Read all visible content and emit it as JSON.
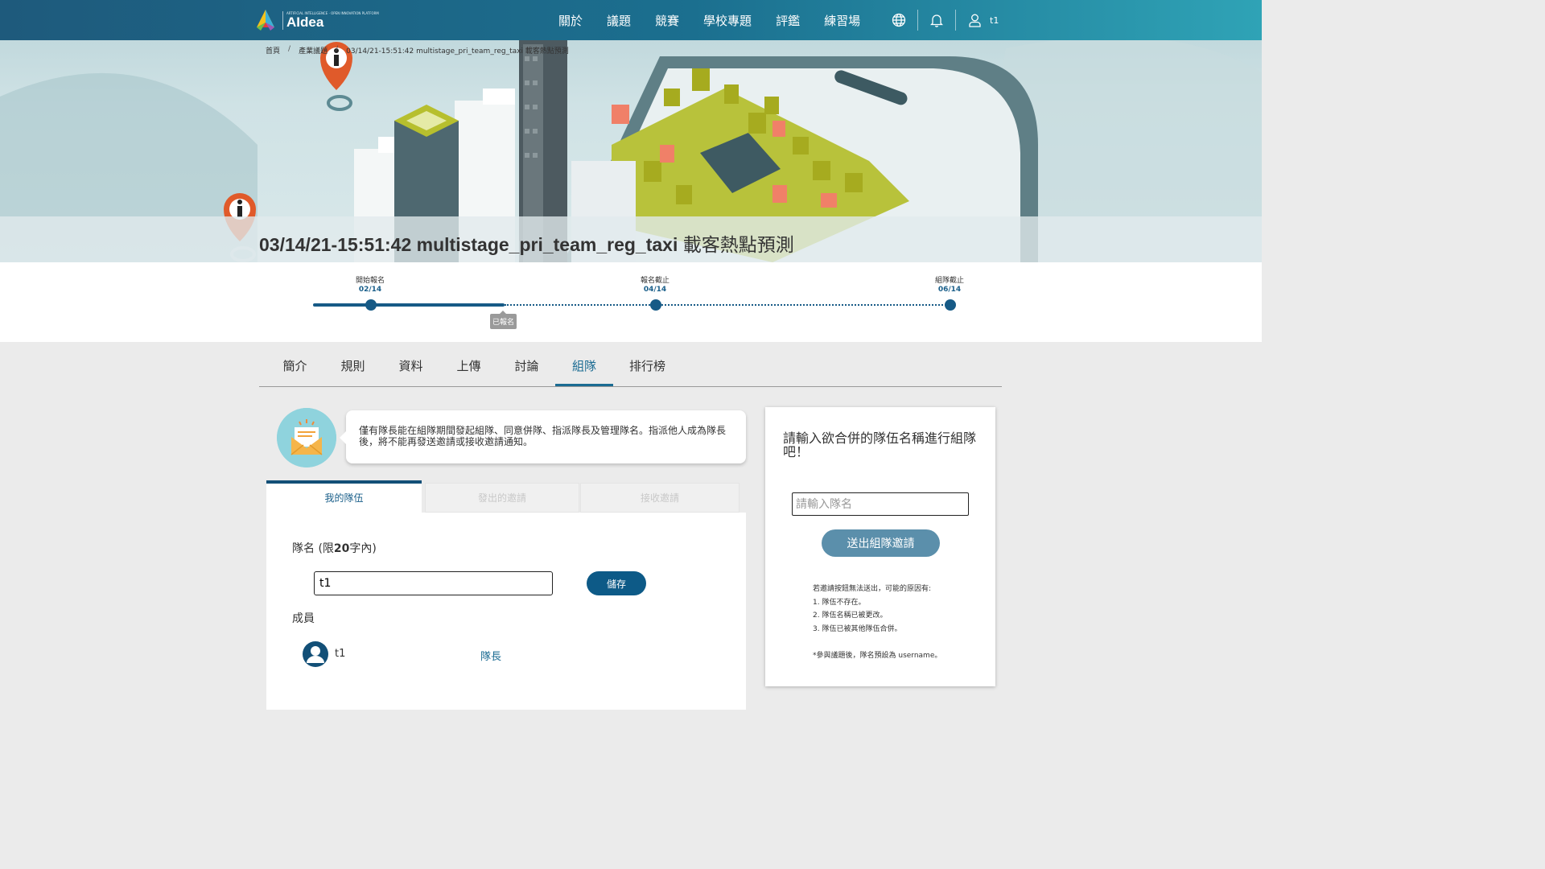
{
  "nav": {
    "logo_small": "ARTIFICIAL INTELLIGENCE · OPEN INNOVATION PLATFORM",
    "logo_name": "AIdea",
    "links": [
      "關於",
      "議題",
      "競賽",
      "學校專題",
      "評鑑",
      "練習場"
    ],
    "user": "t1"
  },
  "breadcrumb": [
    "首頁",
    "產業議題",
    "03/14/21-15:51:42 multistage_pri_team_reg_taxi 載客熱點預測"
  ],
  "title": {
    "en": "03/14/21-15:51:42 multistage_pri_team_reg_taxi ",
    "zh": "載客熱點預測"
  },
  "timeline": {
    "stages": [
      {
        "label": "開始報名",
        "date": "02/14"
      },
      {
        "label": "報名截止",
        "date": "04/14"
      },
      {
        "label": "組隊截止",
        "date": "06/14"
      }
    ],
    "progress": 0.3,
    "badge": "已報名"
  },
  "tabs": [
    "簡介",
    "規則",
    "資料",
    "上傳",
    "討論",
    "組隊",
    "排行榜"
  ],
  "active_tab": "組隊",
  "notice": "僅有隊長能在組隊期間發起組隊、同意併隊、指派隊長及管理隊名。指派他人成為隊長後，將不能再發送邀請或接收邀請通知。",
  "team_tabs": [
    "我的隊伍",
    "發出的邀請",
    "接收邀請"
  ],
  "team": {
    "name_label": "隊名 (限",
    "name_limit": "20",
    "name_label_end": "字內)",
    "name_value": "t1",
    "save": "儲存",
    "members_label": "成員",
    "members": [
      {
        "name": "t1",
        "role": "隊長"
      }
    ]
  },
  "merge": {
    "heading": "請輸入欲合併的隊伍名稱進行組隊吧！",
    "placeholder": "請輸入隊名",
    "button": "送出組隊邀請",
    "notes": [
      "若邀請按鈕無法送出，可能的原因有:",
      "1. 隊伍不存在。",
      "2. 隊伍名稱已被更改。",
      "3. 隊伍已被其他隊伍合併。",
      "",
      "*參與議題後，隊名預設為 username。"
    ]
  },
  "colors": {
    "primary": "#124f77",
    "accent": "#1a6b92",
    "nav_start": "#1e5a7c",
    "nav_end": "#2fa3b6"
  }
}
